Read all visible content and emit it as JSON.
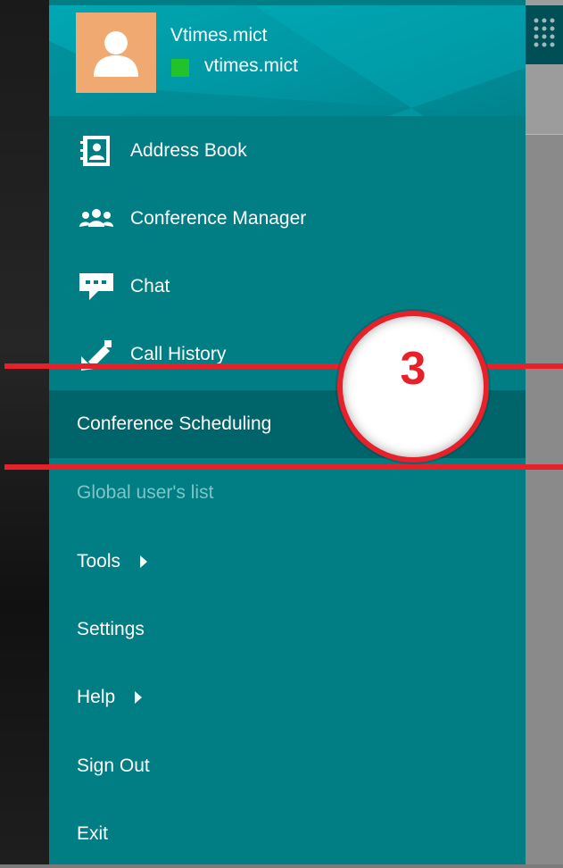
{
  "user": {
    "display_name": "Vtimes.mict",
    "account": "vtimes.mict",
    "status_color": "#22c32a"
  },
  "menu": {
    "items": [
      {
        "label": "Address Book",
        "icon": "address-book-icon"
      },
      {
        "label": "Conference Manager",
        "icon": "conference-manager-icon"
      },
      {
        "label": "Chat",
        "icon": "chat-icon"
      },
      {
        "label": "Call History",
        "icon": "call-history-icon"
      },
      {
        "label": "Conference Scheduling",
        "state": "selected"
      },
      {
        "label": "Global user's list",
        "state": "disabled"
      },
      {
        "label": "Tools",
        "submenu": true
      },
      {
        "label": "Settings"
      },
      {
        "label": "Help",
        "submenu": true
      },
      {
        "label": "Sign Out"
      },
      {
        "label": "Exit"
      }
    ]
  },
  "annotation": {
    "step_number": "3",
    "color": "#e8202a"
  },
  "colors": {
    "panel": "#007e84",
    "header": "#00a7b4",
    "selected": "#00656b",
    "avatar": "#f0a970"
  }
}
